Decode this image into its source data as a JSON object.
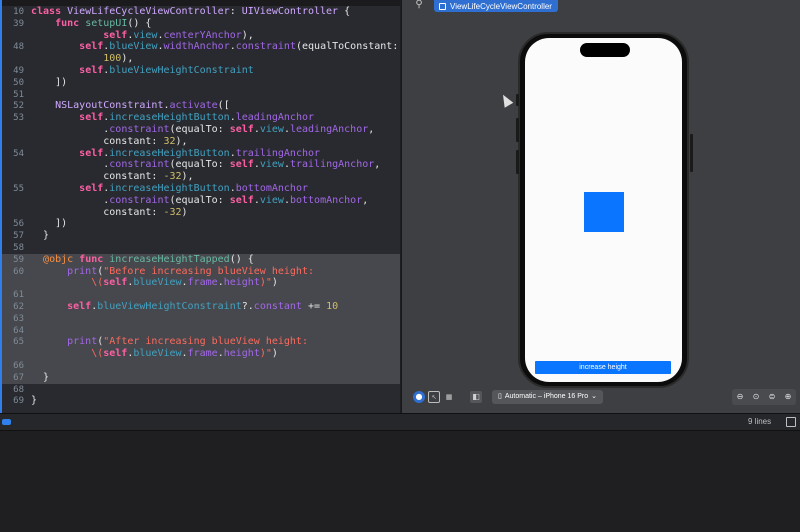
{
  "editor": {
    "lines": [
      {
        "n": "10",
        "t": [
          [
            "kw",
            "class "
          ],
          [
            "ty",
            "ViewLifeCycleViewController"
          ],
          [
            "pl",
            ": "
          ],
          [
            "ty",
            "UIViewController"
          ],
          [
            "pl",
            " {"
          ]
        ]
      },
      {
        "n": "39",
        "t": [
          [
            "pl",
            "    "
          ],
          [
            "kw",
            "func "
          ],
          [
            "fn",
            "setupUI"
          ],
          [
            "pl",
            "() {"
          ]
        ]
      },
      {
        "n": "",
        "t": [
          [
            "pl",
            "            "
          ],
          [
            "kw",
            "self"
          ],
          [
            "pl",
            "."
          ],
          [
            "fd",
            "view"
          ],
          [
            "pl",
            "."
          ],
          [
            "pr",
            "centerYAnchor"
          ],
          [
            "pl",
            "),"
          ]
        ]
      },
      {
        "n": "48",
        "t": [
          [
            "pl",
            "        "
          ],
          [
            "kw",
            "self"
          ],
          [
            "pl",
            "."
          ],
          [
            "fd",
            "blueView"
          ],
          [
            "pl",
            "."
          ],
          [
            "pr",
            "widthAnchor"
          ],
          [
            "pl",
            "."
          ],
          [
            "pr",
            "constraint"
          ],
          [
            "pl",
            "(equalToConstant:"
          ]
        ]
      },
      {
        "n": "",
        "t": [
          [
            "pl",
            "            "
          ],
          [
            "nm",
            "100"
          ],
          [
            "pl",
            "),"
          ]
        ]
      },
      {
        "n": "49",
        "t": [
          [
            "pl",
            "        "
          ],
          [
            "kw",
            "self"
          ],
          [
            "pl",
            "."
          ],
          [
            "fd",
            "blueViewHeightConstraint"
          ]
        ]
      },
      {
        "n": "50",
        "t": [
          [
            "pl",
            "    ])"
          ]
        ]
      },
      {
        "n": "51",
        "t": []
      },
      {
        "n": "52",
        "t": [
          [
            "pl",
            "    "
          ],
          [
            "ty",
            "NSLayoutConstraint"
          ],
          [
            "pl",
            "."
          ],
          [
            "pr",
            "activate"
          ],
          [
            "pl",
            "(["
          ]
        ]
      },
      {
        "n": "53",
        "t": [
          [
            "pl",
            "        "
          ],
          [
            "kw",
            "self"
          ],
          [
            "pl",
            "."
          ],
          [
            "fd",
            "increaseHeightButton"
          ],
          [
            "pl",
            "."
          ],
          [
            "pr",
            "leadingAnchor"
          ]
        ]
      },
      {
        "n": "",
        "t": [
          [
            "pl",
            "            ."
          ],
          [
            "pr",
            "constraint"
          ],
          [
            "pl",
            "(equalTo: "
          ],
          [
            "kw",
            "self"
          ],
          [
            "pl",
            "."
          ],
          [
            "fd",
            "view"
          ],
          [
            "pl",
            "."
          ],
          [
            "pr",
            "leadingAnchor"
          ],
          [
            "pl",
            ","
          ]
        ]
      },
      {
        "n": "",
        "t": [
          [
            "pl",
            "            constant: "
          ],
          [
            "nm",
            "32"
          ],
          [
            "pl",
            "),"
          ]
        ]
      },
      {
        "n": "54",
        "t": [
          [
            "pl",
            "        "
          ],
          [
            "kw",
            "self"
          ],
          [
            "pl",
            "."
          ],
          [
            "fd",
            "increaseHeightButton"
          ],
          [
            "pl",
            "."
          ],
          [
            "pr",
            "trailingAnchor"
          ]
        ]
      },
      {
        "n": "",
        "t": [
          [
            "pl",
            "            ."
          ],
          [
            "pr",
            "constraint"
          ],
          [
            "pl",
            "(equalTo: "
          ],
          [
            "kw",
            "self"
          ],
          [
            "pl",
            "."
          ],
          [
            "fd",
            "view"
          ],
          [
            "pl",
            "."
          ],
          [
            "pr",
            "trailingAnchor"
          ],
          [
            "pl",
            ","
          ]
        ]
      },
      {
        "n": "",
        "t": [
          [
            "pl",
            "            constant: "
          ],
          [
            "nm",
            "-32"
          ],
          [
            "pl",
            "),"
          ]
        ]
      },
      {
        "n": "55",
        "t": [
          [
            "pl",
            "        "
          ],
          [
            "kw",
            "self"
          ],
          [
            "pl",
            "."
          ],
          [
            "fd",
            "increaseHeightButton"
          ],
          [
            "pl",
            "."
          ],
          [
            "pr",
            "bottomAnchor"
          ]
        ]
      },
      {
        "n": "",
        "t": [
          [
            "pl",
            "            ."
          ],
          [
            "pr",
            "constraint"
          ],
          [
            "pl",
            "(equalTo: "
          ],
          [
            "kw",
            "self"
          ],
          [
            "pl",
            "."
          ],
          [
            "fd",
            "view"
          ],
          [
            "pl",
            "."
          ],
          [
            "pr",
            "bottomAnchor"
          ],
          [
            "pl",
            ","
          ]
        ]
      },
      {
        "n": "",
        "t": [
          [
            "pl",
            "            constant: "
          ],
          [
            "nm",
            "-32"
          ],
          [
            "pl",
            ")"
          ]
        ]
      },
      {
        "n": "56",
        "t": [
          [
            "pl",
            "    ])"
          ]
        ]
      },
      {
        "n": "57",
        "t": [
          [
            "pl",
            "  }"
          ]
        ]
      },
      {
        "n": "58",
        "t": []
      },
      {
        "n": "59",
        "hl": true,
        "t": [
          [
            "pl",
            "  "
          ],
          [
            "at",
            "@objc "
          ],
          [
            "kw",
            "func "
          ],
          [
            "fn",
            "increaseHeightTapped"
          ],
          [
            "pl",
            "() {"
          ]
        ]
      },
      {
        "n": "60",
        "hl": true,
        "t": [
          [
            "pl",
            "      "
          ],
          [
            "pr",
            "print"
          ],
          [
            "pl",
            "("
          ],
          [
            "st",
            "\"Before increasing blueView height:"
          ]
        ]
      },
      {
        "n": "",
        "hl": true,
        "t": [
          [
            "st",
            "          \\("
          ],
          [
            "kw",
            "self"
          ],
          [
            "pl",
            "."
          ],
          [
            "fd",
            "blueView"
          ],
          [
            "pl",
            "."
          ],
          [
            "pr",
            "frame"
          ],
          [
            "pl",
            "."
          ],
          [
            "pr",
            "height"
          ],
          [
            "st",
            ")\""
          ],
          [
            "pl",
            ")"
          ]
        ]
      },
      {
        "n": "61",
        "hl": true,
        "t": []
      },
      {
        "n": "62",
        "hl": true,
        "t": [
          [
            "pl",
            "      "
          ],
          [
            "kw",
            "self"
          ],
          [
            "pl",
            "."
          ],
          [
            "fd",
            "blueViewHeightConstraint"
          ],
          [
            "pl",
            "?."
          ],
          [
            "pr",
            "constant"
          ],
          [
            "pl",
            " += "
          ],
          [
            "nm",
            "10"
          ]
        ]
      },
      {
        "n": "63",
        "hl": true,
        "t": []
      },
      {
        "n": "64",
        "hl": true,
        "t": []
      },
      {
        "n": "65",
        "hl": true,
        "t": [
          [
            "pl",
            "      "
          ],
          [
            "pr",
            "print"
          ],
          [
            "pl",
            "("
          ],
          [
            "st",
            "\"After increasing blueView height:"
          ]
        ]
      },
      {
        "n": "",
        "hl": true,
        "t": [
          [
            "st",
            "          \\("
          ],
          [
            "kw",
            "self"
          ],
          [
            "pl",
            "."
          ],
          [
            "fd",
            "blueView"
          ],
          [
            "pl",
            "."
          ],
          [
            "pr",
            "frame"
          ],
          [
            "pl",
            "."
          ],
          [
            "pr",
            "height"
          ],
          [
            "st",
            ")\""
          ],
          [
            "pl",
            ")"
          ]
        ]
      },
      {
        "n": "66",
        "hl": true,
        "t": []
      },
      {
        "n": "67",
        "hl": true,
        "t": [
          [
            "pl",
            "  }"
          ]
        ]
      },
      {
        "n": "68",
        "t": []
      },
      {
        "n": "69",
        "t": [
          [
            "pl",
            "}"
          ]
        ]
      }
    ]
  },
  "canvas": {
    "tab_label": "ViewLifeCycleViewController",
    "increase_button_label": "increase height",
    "device_label": "Automatic – iPhone 16 Pro",
    "device_chevron": "⌄"
  },
  "icons": {
    "pin": "pin-icon",
    "live": "play-circle-icon",
    "select": "cursor-select-icon",
    "variants": "grid-variants-icon",
    "device_settings": "device-settings-icon",
    "zoom_out": "zoom-out-icon",
    "zoom_fit": "zoom-fit-icon",
    "zoom_100": "zoom-actual-icon",
    "zoom_in": "zoom-in-icon"
  },
  "debug": {
    "lines_count": "9 lines"
  },
  "colors": {
    "accent": "#2f6fd1",
    "ui_blue": "#0a76ff"
  }
}
